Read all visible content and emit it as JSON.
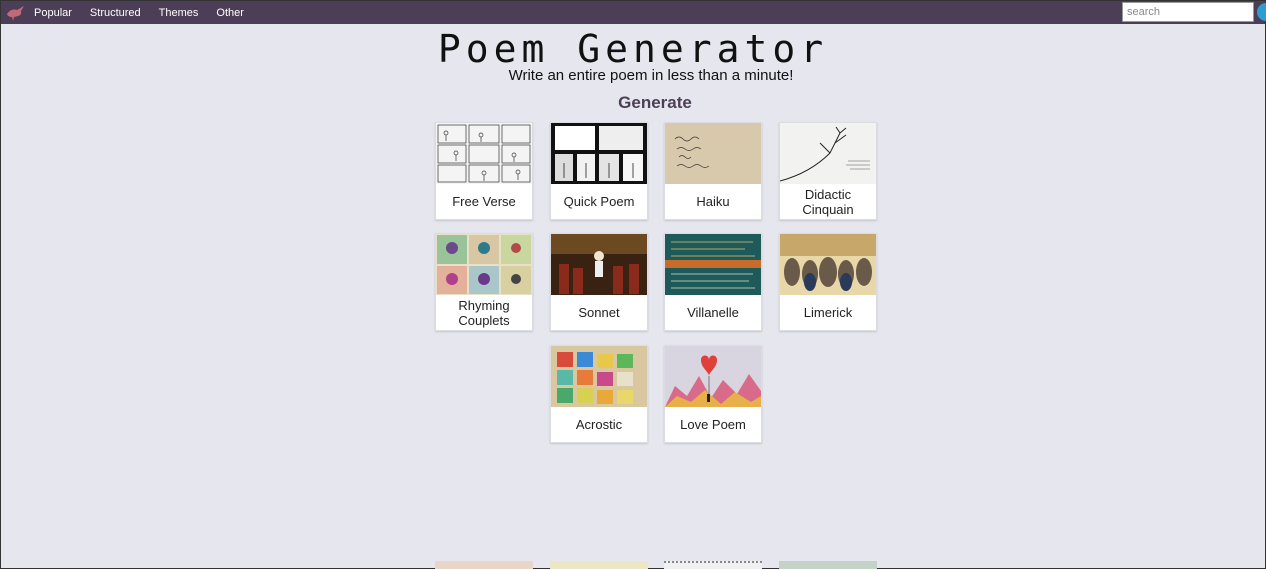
{
  "nav": {
    "items": [
      {
        "label": "Popular"
      },
      {
        "label": "Structured"
      },
      {
        "label": "Themes"
      },
      {
        "label": "Other"
      }
    ],
    "search_placeholder": "search"
  },
  "header": {
    "title": "Poem Generator",
    "subtitle": "Write an entire poem in less than a minute!",
    "section": "Generate"
  },
  "cards": [
    {
      "label": "Free Verse",
      "thumb": "comic-strip-sketch"
    },
    {
      "label": "Quick Poem",
      "thumb": "black-white-comic-panels"
    },
    {
      "label": "Haiku",
      "thumb": "handwritten-note"
    },
    {
      "label": "Didactic Cinquain",
      "thumb": "ink-tree-drawing"
    },
    {
      "label": "Rhyming Couplets",
      "thumb": "colorful-figure-panels"
    },
    {
      "label": "Sonnet",
      "thumb": "theatre-painting"
    },
    {
      "label": "Villanelle",
      "thumb": "chalkboard-text"
    },
    {
      "label": "Limerick",
      "thumb": "owls-illustration"
    },
    {
      "label": "Acrostic",
      "thumb": "alphabet-blocks"
    },
    {
      "label": "Love Poem",
      "thumb": "heart-balloon-painting"
    }
  ],
  "colors": {
    "topbar": "#4d3e58",
    "background": "#e6e7ee",
    "accent": "#4d3e58",
    "search_button": "#2a9fd0"
  }
}
